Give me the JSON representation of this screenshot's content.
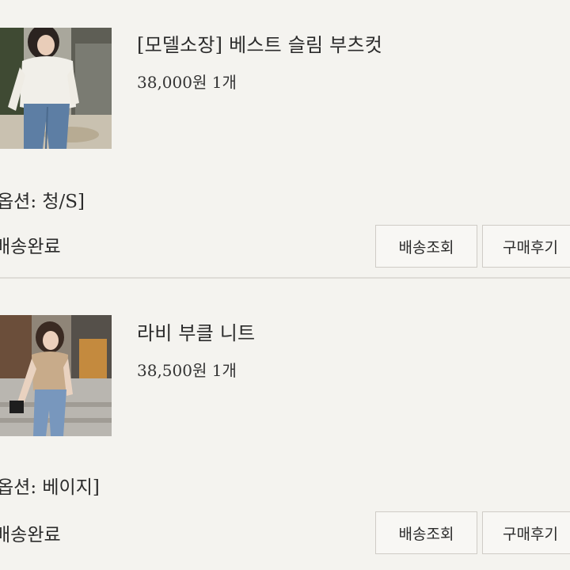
{
  "orders": [
    {
      "product_name": "[모델소장] 베스트 슬림 부츠컷",
      "price_qty": "38,000원 1개",
      "option": "옵션: 청/S]",
      "status": "배송완료",
      "track_button": "배송조회",
      "review_button": "구매후기"
    },
    {
      "product_name": "라비 부클 니트",
      "price_qty": "38,500원 1개",
      "option": "옵션: 베이지]",
      "status": "배송완료",
      "track_button": "배송조회",
      "review_button": "구매후기"
    }
  ]
}
